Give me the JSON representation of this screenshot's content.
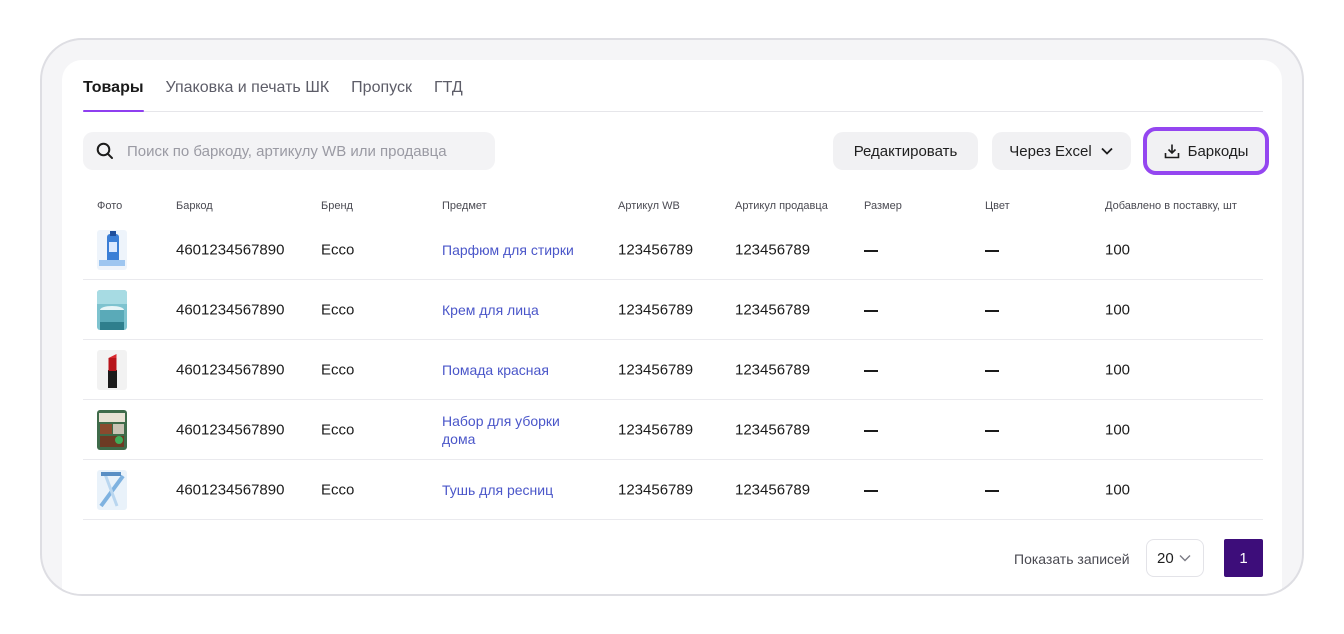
{
  "tabs": [
    {
      "label": "Товары",
      "active": true
    },
    {
      "label": "Упаковка и печать ШК",
      "active": false
    },
    {
      "label": "Пропуск",
      "active": false
    },
    {
      "label": "ГТД",
      "active": false
    }
  ],
  "search": {
    "placeholder": "Поиск по баркоду, артикулу WB или продавца",
    "icon": "search-icon"
  },
  "toolbar": {
    "edit_label": "Редактировать",
    "excel_label": "Через Excel",
    "barcodes_label": "Баркоды",
    "highlight_color": "#9446f0"
  },
  "table": {
    "headers": [
      "Фото",
      "Баркод",
      "Бренд",
      "Предмет",
      "Артикул WB",
      "Артикул продавца",
      "Размер",
      "Цвет",
      "Добавлено в поставку, шт"
    ],
    "rows": [
      {
        "photo": "stain-remover-bottle",
        "barcode": "4601234567890",
        "brand": "Ecco",
        "subject": "Парфюм для стирки",
        "article_wb": "123456789",
        "article_seller": "123456789",
        "size": "—",
        "color": "—",
        "qty": "100"
      },
      {
        "photo": "face-cream-jar",
        "barcode": "4601234567890",
        "brand": "Ecco",
        "subject": "Крем для лица",
        "article_wb": "123456789",
        "article_seller": "123456789",
        "size": "—",
        "color": "—",
        "qty": "100"
      },
      {
        "photo": "red-lipstick",
        "barcode": "4601234567890",
        "brand": "Ecco",
        "subject": "Помада красная",
        "article_wb": "123456789",
        "article_seller": "123456789",
        "size": "—",
        "color": "—",
        "qty": "100"
      },
      {
        "photo": "cleaning-set",
        "barcode": "4601234567890",
        "brand": "Ecco",
        "subject": "Набор для уборки дома",
        "article_wb": "123456789",
        "article_seller": "123456789",
        "size": "—",
        "color": "—",
        "qty": "100"
      },
      {
        "photo": "mascara",
        "barcode": "4601234567890",
        "brand": "Ecco",
        "subject": "Тушь для ресниц",
        "article_wb": "123456789",
        "article_seller": "123456789",
        "size": "—",
        "color": "—",
        "qty": "100"
      }
    ]
  },
  "pagination": {
    "label": "Показать записей",
    "page_size": "20",
    "current_page": "1",
    "accent": "#3d0d7a"
  }
}
